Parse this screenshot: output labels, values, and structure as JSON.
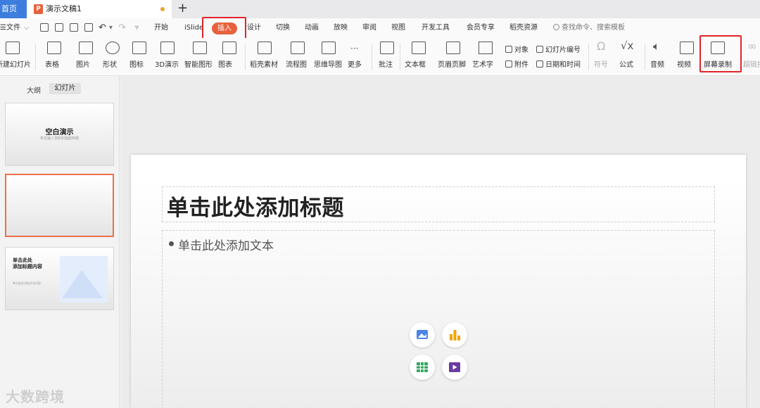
{
  "tabs": {
    "home": "首页",
    "doc": "演示文稿1"
  },
  "menu": {
    "file": "文件",
    "items": [
      "开始",
      "iSlide",
      "插入",
      "设计",
      "切换",
      "动画",
      "放映",
      "审阅",
      "视图",
      "开发工具",
      "会员专享",
      "稻壳资源"
    ],
    "active": "插入",
    "search_placeholder": "查找命令、搜索模板"
  },
  "ribbon": {
    "new_slide": "新建幻灯片",
    "table": "表格",
    "picture": "图片",
    "shape": "形状",
    "icon": "图标",
    "threed": "3D演示",
    "smart": "智能图形",
    "chart": "图表",
    "docer": "稻壳素材",
    "flowchart": "流程图",
    "mindmap": "思维导图",
    "more": "更多",
    "comment": "批注",
    "textbox": "文本框",
    "header": "页眉页脚",
    "arttext": "艺术字",
    "object": "对象",
    "attachment": "附件",
    "slide_num": "幻灯片编号",
    "datetime": "日期和时间",
    "symbol": "符号",
    "formula": "公式",
    "audio": "音频",
    "video": "视频",
    "screenrec": "屏幕录制",
    "hyperlink": "超链接"
  },
  "leftpanel": {
    "tab_outline": "大纲",
    "tab_slides": "幻灯片",
    "thumb1_title": "空白演示",
    "thumb1_sub": "单击输入您的封面副标题",
    "thumb3_title_1": "单击此处",
    "thumb3_title_2": "添加标题内容",
    "thumb3_sub": "单击此处添加文本内容"
  },
  "slide": {
    "title_placeholder": "单击此处添加标题",
    "body_placeholder": "单击此处添加文本"
  },
  "watermark": "大数跨境",
  "colors": {
    "accent": "#e8613c",
    "highlight": "#e0252a",
    "home_tab": "#3d7ddd"
  }
}
